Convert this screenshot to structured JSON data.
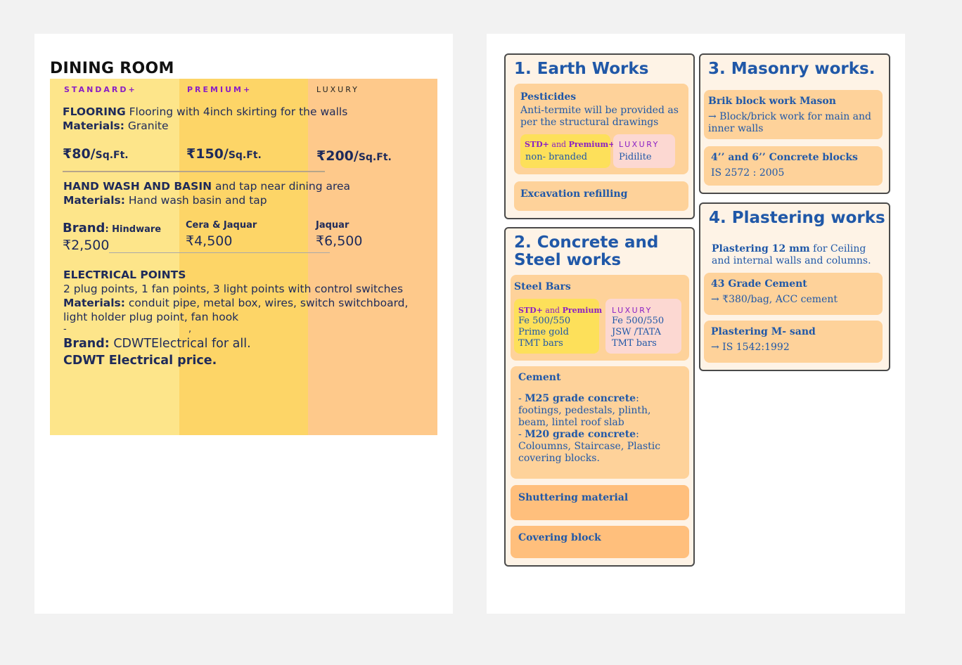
{
  "dining": {
    "title": "DINING ROOM",
    "tiers": {
      "standard": "STANDARD+",
      "premium": "PREMIUM+",
      "luxury": "LUXURY"
    },
    "flooring": {
      "heading": "FLOORING",
      "desc": " Flooring with 4inch skirting for the walls",
      "materials_label": "Materials:",
      "materials": " Granite",
      "std_price": "₹80/",
      "prem_price": "₹150/",
      "lux_price": "₹200/",
      "unit": "Sq.Ft."
    },
    "handwash": {
      "heading": "HAND WASH AND BASIN",
      "desc": " and tap near dining area",
      "materials_label": "Materials:",
      "materials": " Hand wash basin and tap",
      "brand_label": "Brand",
      "std_brand": ": Hindware",
      "std_price": "₹2,500",
      "prem_brand": "Cera & Jaquar",
      "prem_price": "₹4,500",
      "lux_brand": "Jaquar",
      "lux_price": "₹6,500"
    },
    "electrical": {
      "heading": "ELECTRICAL POINTS",
      "line1": "2 plug points,  1 fan points, 3 light points with control switches",
      "materials_label": "Materials:",
      "materials": " conduit pipe, metal  box, wires, switch switchboard,",
      "line3": "light  holder plug point, fan  hook",
      "dash": "-",
      "comma": ",",
      "brand_label": "Brand:",
      "brand": " CDWTElectrical for all.",
      "price_note": "CDWT Electrical price."
    }
  },
  "earth": {
    "title": "1. Earth Works",
    "pesticides_title": "Pesticides",
    "pesticides_desc": "Anti-termite will be provided as per the structural drawings",
    "std_tag": "STD+",
    "and": " and ",
    "prem_tag": "Premium+",
    "std_value": "non- branded",
    "lux_tag": "LUXURY",
    "lux_value": "Pidilite",
    "excavation": "Excavation refilling"
  },
  "concrete": {
    "title": "2. Concrete and Steel works",
    "steel_title": "Steel Bars",
    "std_tag": "STD+",
    "and": " and ",
    "prem_tag": "Premium",
    "std_line1": "Fe 500/550",
    "std_line2": "Prime gold",
    "std_line3": "TMT bars",
    "lux_tag": "LUXURY",
    "lux_line1": "Fe 500/550",
    "lux_line2": "JSW /TATA",
    "lux_line3": "TMT bars",
    "cement_title": "Cement",
    "m25_prefix": "- ",
    "m25": "M25 grade concrete",
    "m25_desc": ": footings, pedestals, plinth, beam, lintel roof slab",
    "m20_prefix": "- ",
    "m20": "M20 grade concrete",
    "m20_desc": ": Coloumns, Staircase, Plastic covering blocks.",
    "shuttering": "Shuttering material",
    "covering": "Covering block"
  },
  "masonry": {
    "title": "3. Masonry works.",
    "brick_title": "Brik block work Mason",
    "brick_desc": "→ Block/brick work for main and inner walls",
    "blocks_title": "4’’ and 6’’ Concrete blocks",
    "blocks_desc": "IS 2572 : 2005"
  },
  "plastering": {
    "title": "4. Plastering works",
    "intro_bold": "Plastering 12 mm",
    "intro": " for Ceiling and internal walls and columns.",
    "cement_title": "43 Grade Cement",
    "cement_desc": "→ ₹380/bag, ACC cement",
    "sand_title": "Plastering M- sand",
    "sand_desc": "→ IS 1542:1992"
  }
}
